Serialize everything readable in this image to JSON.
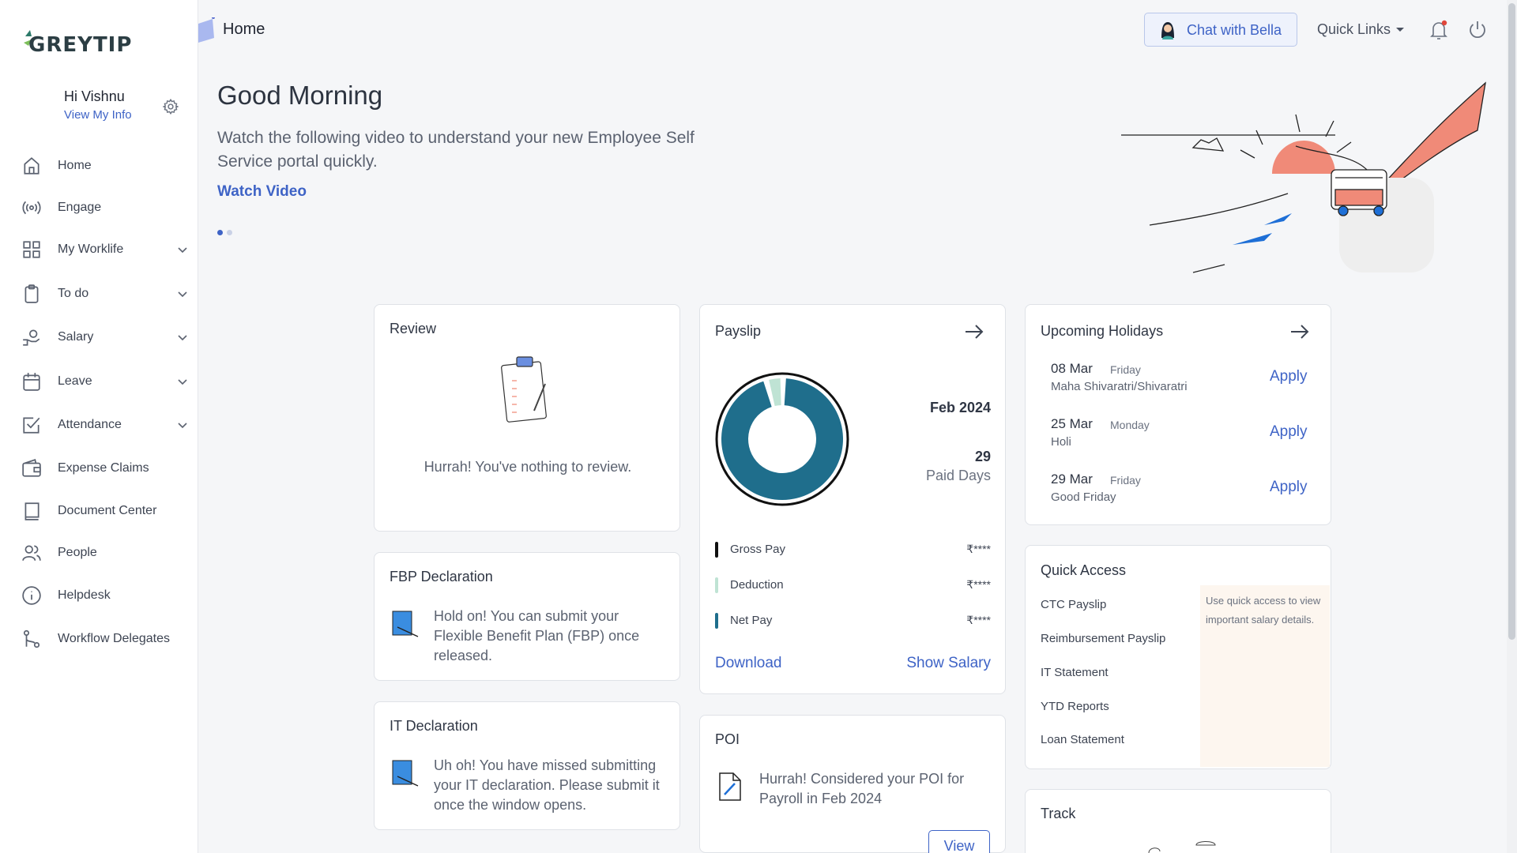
{
  "brand": {
    "logo_text": "GREYTIP"
  },
  "user": {
    "greeting": "Hi Vishnu",
    "view_info": "View My Info"
  },
  "nav": [
    {
      "label": "Home",
      "icon": "home-icon",
      "expandable": false
    },
    {
      "label": "Engage",
      "icon": "broadcast-icon",
      "expandable": false
    },
    {
      "label": "My Worklife",
      "icon": "grid-icon",
      "expandable": true
    },
    {
      "label": "To do",
      "icon": "clipboard-icon",
      "expandable": true
    },
    {
      "label": "Salary",
      "icon": "salary-hand-icon",
      "expandable": true
    },
    {
      "label": "Leave",
      "icon": "calendar-icon",
      "expandable": true
    },
    {
      "label": "Attendance",
      "icon": "checkbox-icon",
      "expandable": true
    },
    {
      "label": "Expense Claims",
      "icon": "wallet-icon",
      "expandable": false
    },
    {
      "label": "Document Center",
      "icon": "book-icon",
      "expandable": false
    },
    {
      "label": "People",
      "icon": "people-icon",
      "expandable": false
    },
    {
      "label": "Helpdesk",
      "icon": "info-icon",
      "expandable": false
    },
    {
      "label": "Workflow Delegates",
      "icon": "workflow-icon",
      "expandable": false
    }
  ],
  "header": {
    "page_title": "Home",
    "chat_label": "Chat with Bella",
    "quick_links": "Quick Links"
  },
  "hero": {
    "title": "Good Morning",
    "text": "Watch the following video to understand your new Employee Self Service portal quickly.",
    "link": "Watch Video",
    "slides": 2,
    "active_slide": 1
  },
  "review": {
    "title": "Review",
    "message": "Hurrah! You've nothing to review."
  },
  "fbp": {
    "title": "FBP Declaration",
    "message": "Hold on! You can submit your Flexible Benefit Plan (FBP) once released."
  },
  "it": {
    "title": "IT Declaration",
    "message": "Uh oh! You have missed submitting your IT declaration. Please submit it once the window opens."
  },
  "payslip": {
    "title": "Payslip",
    "month": "Feb 2024",
    "paid_days": "29",
    "paid_days_label": "Paid Days",
    "rows": [
      {
        "label": "Gross Pay",
        "value": "₹****",
        "color": "#111111"
      },
      {
        "label": "Deduction",
        "value": "₹****",
        "color": "#bfe3d4"
      },
      {
        "label": "Net Pay",
        "value": "₹****",
        "color": "#1f6e8c"
      }
    ],
    "download": "Download",
    "show_salary": "Show Salary",
    "donut": {
      "net_fraction": 0.96,
      "deduction_fraction": 0.04,
      "net_color": "#1f6e8c",
      "deduction_color": "#bfe3d4"
    }
  },
  "poi": {
    "title": "POI",
    "message": "Hurrah! Considered your POI for Payroll in Feb 2024",
    "view": "View"
  },
  "holidays": {
    "title": "Upcoming Holidays",
    "items": [
      {
        "date": "08 Mar",
        "day": "Friday",
        "name": "Maha Shivaratri/Shivaratri",
        "action": "Apply"
      },
      {
        "date": "25 Mar",
        "day": "Monday",
        "name": "Holi",
        "action": "Apply"
      },
      {
        "date": "29 Mar",
        "day": "Friday",
        "name": "Good Friday",
        "action": "Apply"
      }
    ]
  },
  "quick_access": {
    "title": "Quick Access",
    "items": [
      "CTC Payslip",
      "Reimbursement Payslip",
      "IT Statement",
      "YTD Reports",
      "Loan Statement"
    ],
    "hint": "Use quick access to view important salary details."
  },
  "track": {
    "title": "Track"
  },
  "colors": {
    "accent": "#3e63c6",
    "sunset": "#f08a78"
  }
}
